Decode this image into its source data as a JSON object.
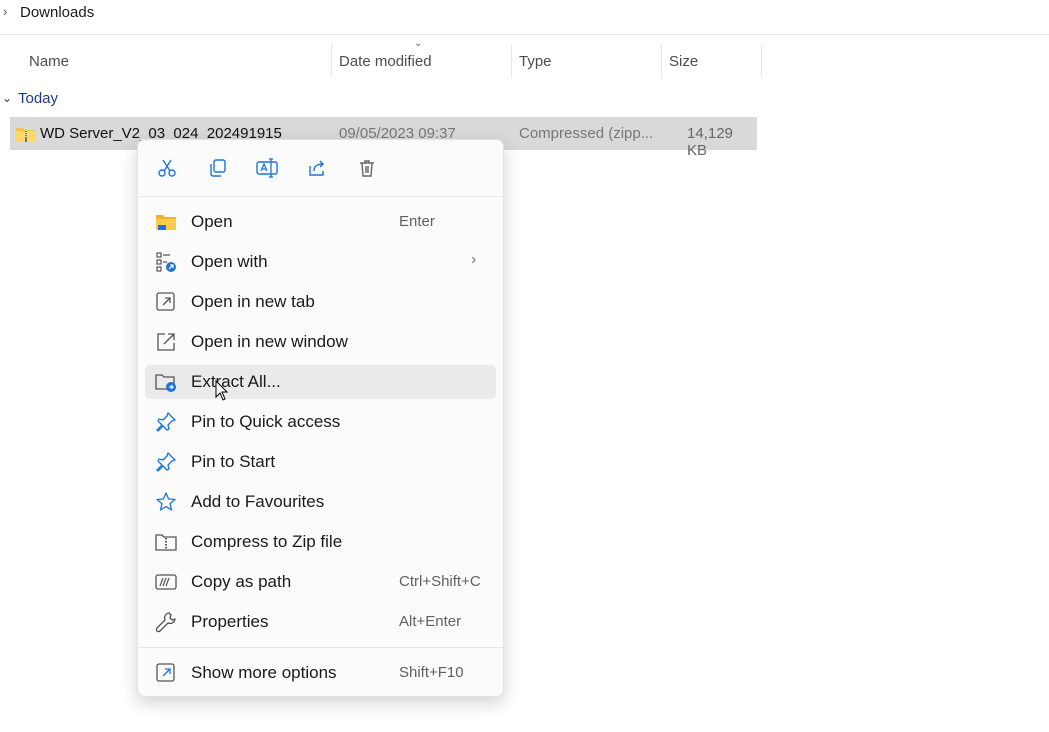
{
  "breadcrumb": {
    "label": "Downloads"
  },
  "columns": {
    "name": "Name",
    "date": "Date modified",
    "type": "Type",
    "size": "Size"
  },
  "group": {
    "label": "Today"
  },
  "file": {
    "name": "WD Server_V2_03_024_202491915",
    "date": "09/05/2023 09:37",
    "type": "Compressed (zipp...",
    "size": "14,129 KB"
  },
  "quick_actions": [
    "cut-icon",
    "copy-icon",
    "rename-icon",
    "share-icon",
    "delete-icon"
  ],
  "menu": {
    "items": [
      {
        "label": "Open",
        "shortcut": "Enter",
        "icon": "folder-icon"
      },
      {
        "label": "Open with",
        "shortcut": "",
        "icon": "open-with-icon",
        "submenu": true
      },
      {
        "label": "Open in new tab",
        "shortcut": "",
        "icon": "new-tab-icon"
      },
      {
        "label": "Open in new window",
        "shortcut": "",
        "icon": "new-window-icon"
      },
      {
        "label": "Extract All...",
        "shortcut": "",
        "icon": "extract-icon"
      },
      {
        "label": "Pin to Quick access",
        "shortcut": "",
        "icon": "pin-icon"
      },
      {
        "label": "Pin to Start",
        "shortcut": "",
        "icon": "pin-icon"
      },
      {
        "label": "Add to Favourites",
        "shortcut": "",
        "icon": "star-icon"
      },
      {
        "label": "Compress to Zip file",
        "shortcut": "",
        "icon": "zip-icon"
      },
      {
        "label": "Copy as path",
        "shortcut": "Ctrl+Shift+C",
        "icon": "copy-path-icon"
      },
      {
        "label": "Properties",
        "shortcut": "Alt+Enter",
        "icon": "wrench-icon"
      },
      {
        "label": "Show more options",
        "shortcut": "Shift+F10",
        "icon": "more-options-icon"
      }
    ]
  },
  "colors": {
    "accent": "#1e73d8",
    "selected_row": "#d9d9d9",
    "group_label": "#1f3a8a"
  }
}
